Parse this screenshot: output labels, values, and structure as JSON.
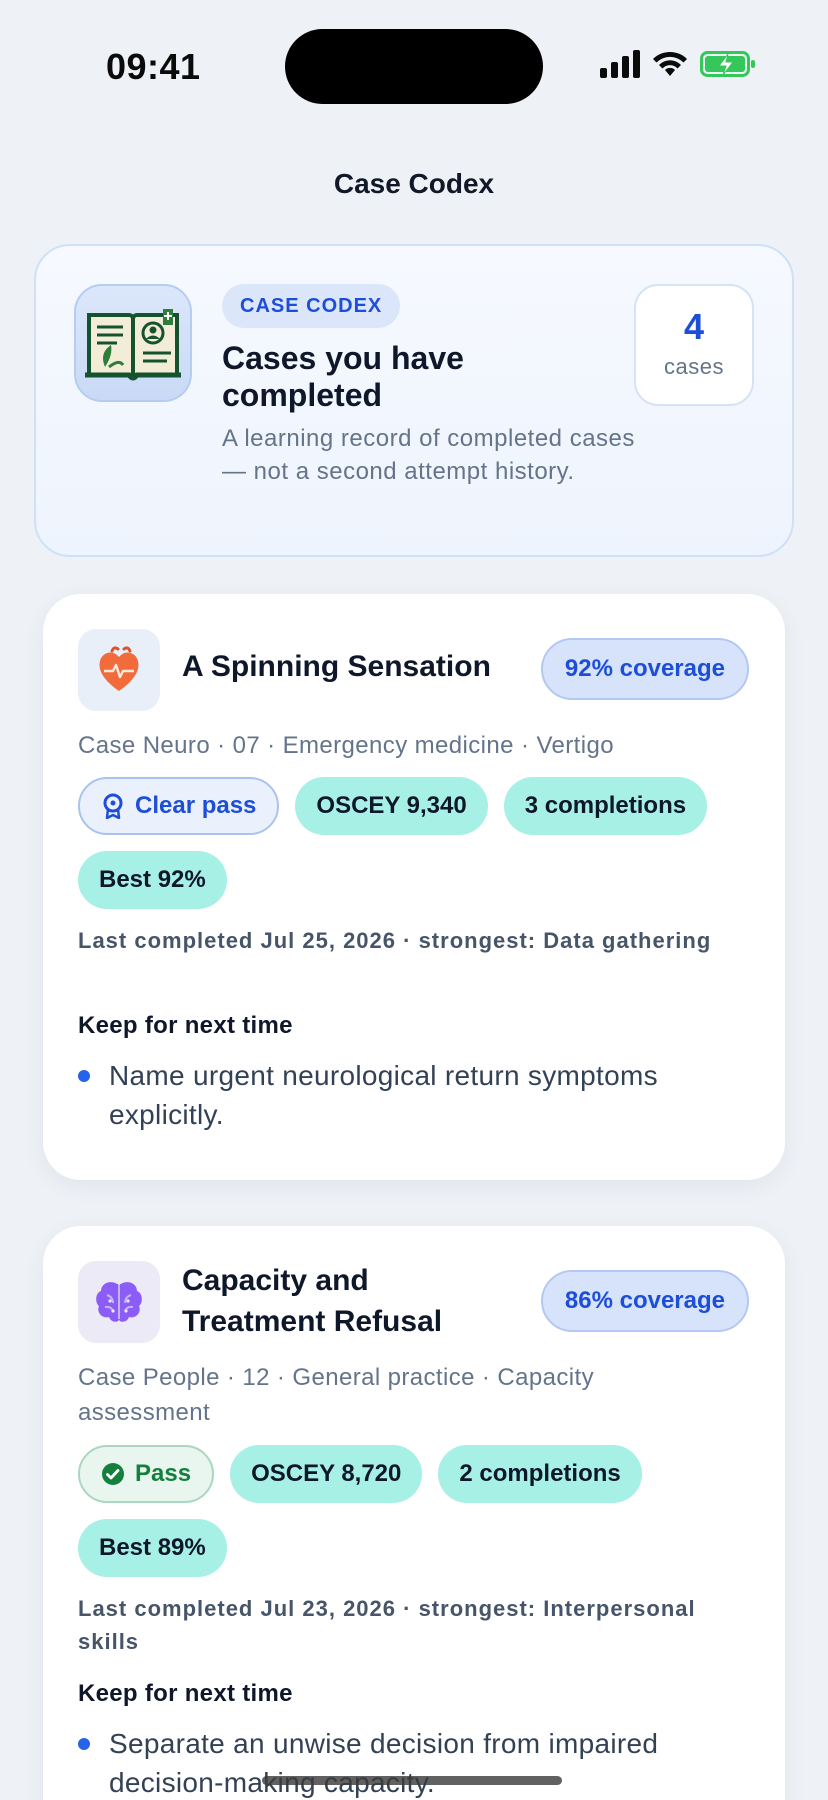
{
  "status_bar": {
    "time": "09:41"
  },
  "nav": {
    "title": "Case Codex"
  },
  "hero": {
    "badge": "CASE CODEX",
    "title": "Cases you have completed",
    "subtitle": "A learning record of completed cases — not a second attempt history.",
    "count_value": "4",
    "count_label": "cases",
    "icon": "open-book-icon"
  },
  "cases": [
    {
      "icon": "heart-icon",
      "title": "A Spinning Sensation",
      "coverage": "92% coverage",
      "meta": "Case Neuro · 07 · Emergency medicine · Vertigo",
      "result": "Clear pass",
      "result_icon": "award-icon",
      "osce": "OSCEY 9,340",
      "completions": "3 completions",
      "best": "Best 92%",
      "last": "Last completed Jul 25, 2026 · strongest: Data gathering",
      "keep_heading": "Keep for next time",
      "keep_item": "Name urgent neurological return symptoms explicitly."
    },
    {
      "icon": "brain-icon",
      "title": "Capacity and Treatment Refusal",
      "coverage": "86% coverage",
      "meta": "Case People · 12 · General practice · Capacity assessment",
      "result": "Pass",
      "result_icon": "check-circle-icon",
      "osce": "OSCEY 8,720",
      "completions": "2 completions",
      "best": "Best 89%",
      "last": "Last completed Jul 23, 2026 · strongest: Interpersonal skills",
      "keep_heading": "Keep for next time",
      "keep_item": "Separate an unwise decision from impaired decision-making capacity."
    }
  ],
  "colors": {
    "accent": "#1d4ed8",
    "teal_chip": "#a7f0e6",
    "background": "#eef2f7"
  }
}
